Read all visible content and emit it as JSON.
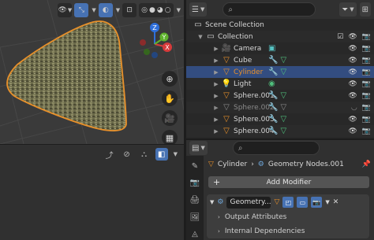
{
  "outliner": {
    "scene_collection": "Scene Collection",
    "collection": "Collection",
    "items": [
      {
        "name": "Camera"
      },
      {
        "name": "Cube"
      },
      {
        "name": "Cylinder"
      },
      {
        "name": "Light"
      },
      {
        "name": "Sphere.001"
      },
      {
        "name": "Sphere.002"
      },
      {
        "name": "Sphere.003"
      },
      {
        "name": "Sphere.004"
      }
    ]
  },
  "gizmo": {
    "x": "X",
    "y": "Y",
    "z": "Z"
  },
  "properties": {
    "object_name": "Cylinder",
    "modifier_path": "Geometry Nodes.001",
    "add_modifier": "Add Modifier",
    "modifier_name": "Geometry...",
    "output_attributes": "Output Attributes",
    "internal_dependencies": "Internal Dependencies"
  },
  "colors": {
    "selection": "#334d80",
    "accent": "#4772b3",
    "object_outline": "#e8902a"
  }
}
